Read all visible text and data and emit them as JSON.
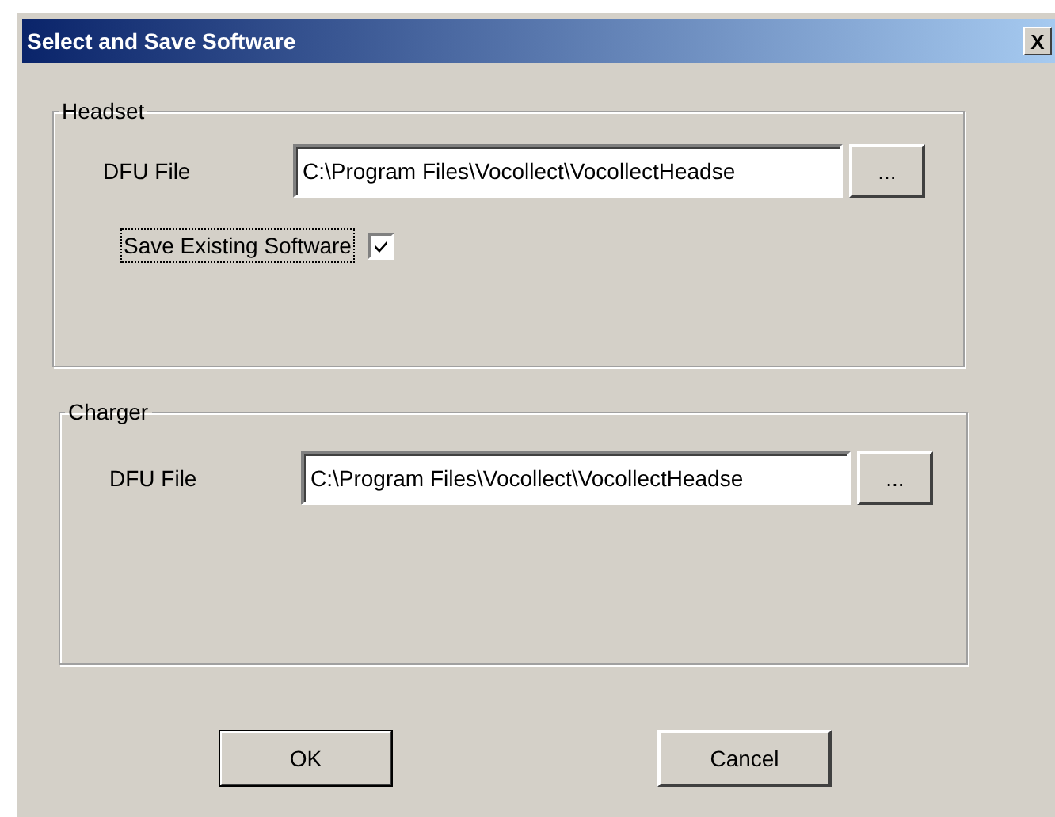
{
  "window": {
    "title": "Select and Save Software",
    "close": "X"
  },
  "groups": [
    {
      "title": "Headset",
      "dfu_label": "DFU File",
      "dfu_value": "C:\\Program Files\\Vocollect\\VocollectHeadse",
      "browse": "...",
      "save_existing": {
        "label": "Save Existing Software",
        "checked": true,
        "focused": true
      }
    },
    {
      "title": "Charger",
      "dfu_label": "DFU File",
      "dfu_value": "C:\\Program Files\\Vocollect\\VocollectHeadse",
      "browse": "..."
    }
  ],
  "buttons": [
    {
      "label": "OK",
      "default": true
    },
    {
      "label": "Cancel",
      "default": false
    }
  ]
}
